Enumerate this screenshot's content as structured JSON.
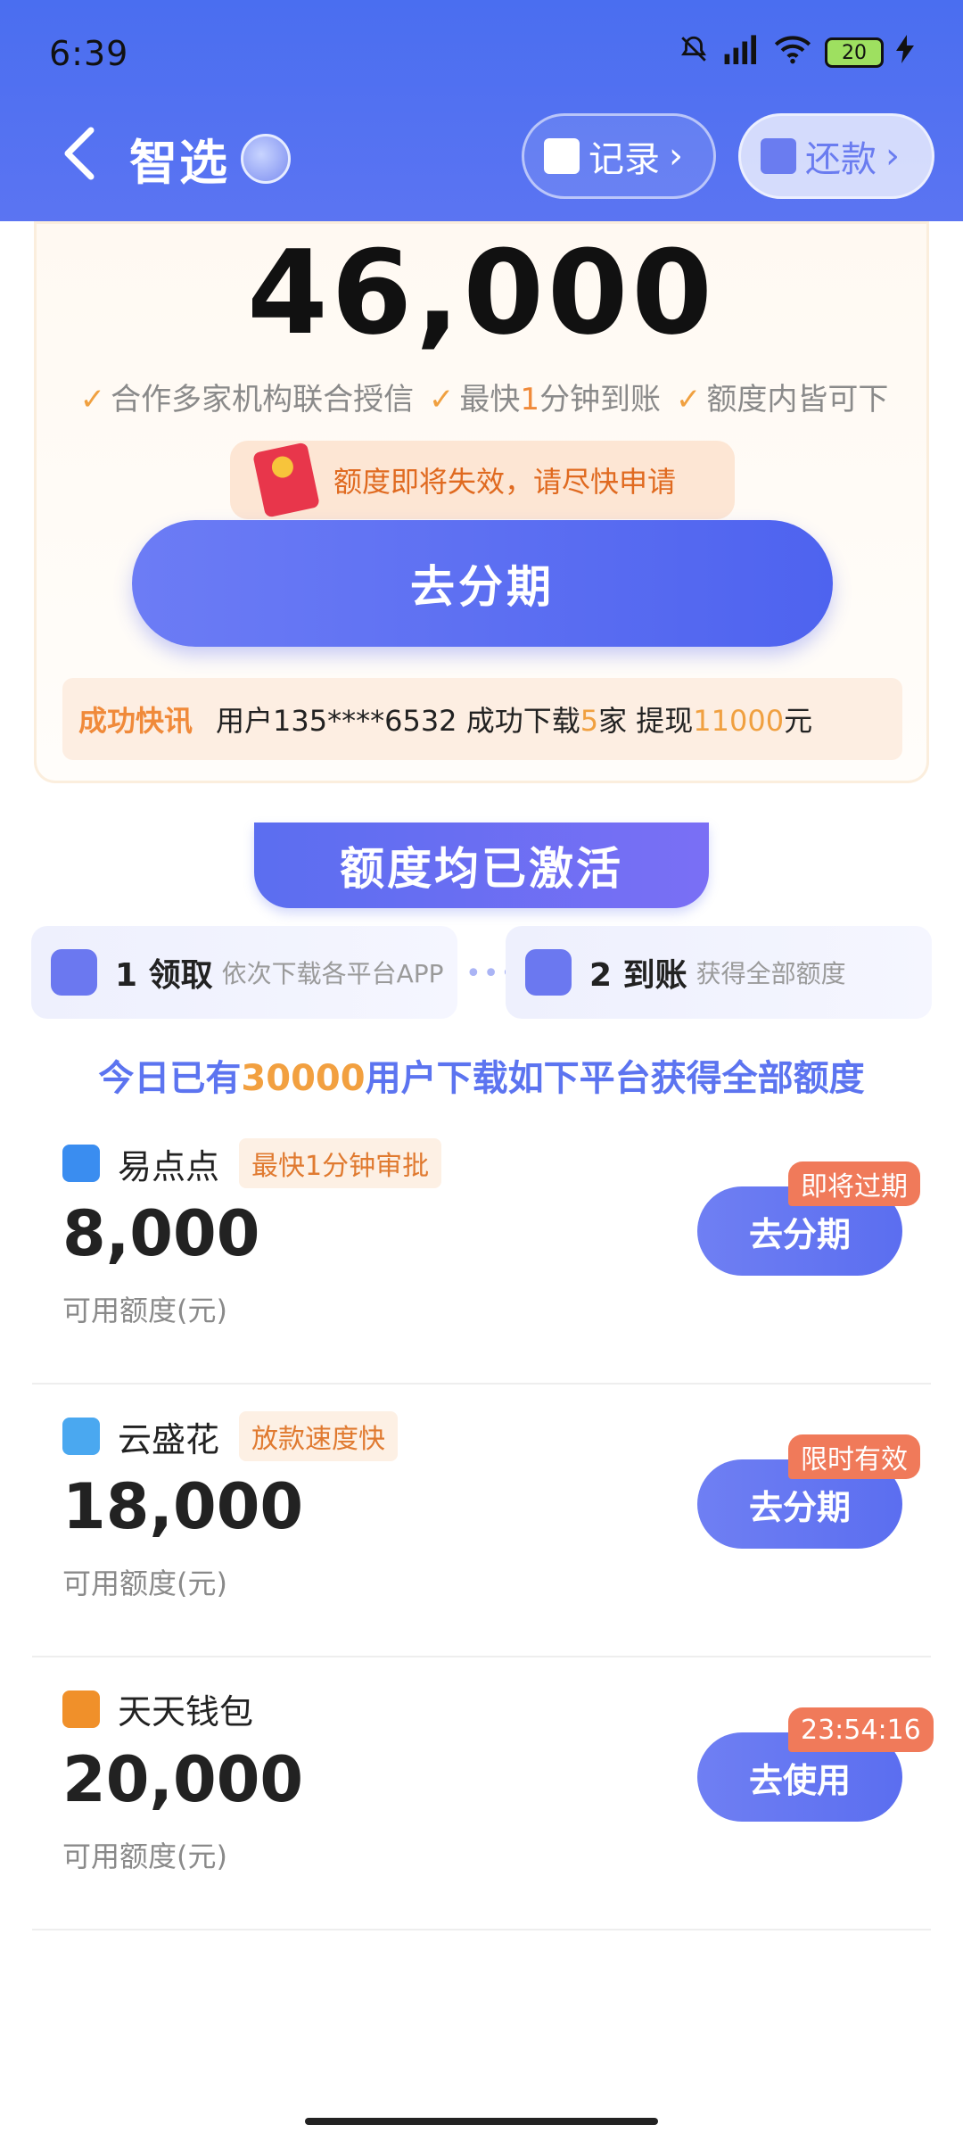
{
  "status_bar": {
    "time": "6:39",
    "battery": "20"
  },
  "nav": {
    "title": "智选",
    "record_label": "记录",
    "repay_label": "还款"
  },
  "hero": {
    "amount": "46,000",
    "features": [
      {
        "pre": "合作多家机构联合授信",
        "hl": "",
        "post": ""
      },
      {
        "pre": "最快",
        "hl": "1",
        "post": "分钟到账"
      },
      {
        "pre": "额度内皆可下",
        "hl": "",
        "post": ""
      }
    ],
    "warning": "额度即将失效，请尽快申请",
    "cta": "去分期"
  },
  "news": {
    "tag": "成功快讯",
    "user": "用户135****6532 成功下载",
    "count": "5",
    "mid": "家 提现",
    "amount": "11000",
    "unit": "元"
  },
  "banner": {
    "title": "额度均已激活"
  },
  "steps": [
    {
      "title": "1 领取",
      "desc": "依次下载各平台APP"
    },
    {
      "title": "2 到账",
      "desc": "获得全部额度"
    }
  ],
  "today": {
    "pre": "今日已有",
    "hl": "30000",
    "post": "用户下载如下平台获得全部额度"
  },
  "items": [
    {
      "name": "易点点",
      "badge": "最快1分钟审批",
      "amount": "8,000",
      "sub": "可用额度(元)",
      "button": "去分期",
      "corner": "即将过期",
      "logo_color": "#3a8df0"
    },
    {
      "name": "云盛花",
      "badge": "放款速度快",
      "amount": "18,000",
      "sub": "可用额度(元)",
      "button": "去分期",
      "corner": "限时有效",
      "logo_color": "#4aa8f0"
    },
    {
      "name": "天天钱包",
      "badge": "",
      "amount": "20,000",
      "sub": "可用额度(元)",
      "button": "去使用",
      "corner": "23:54:16",
      "logo_color": "#f0902a"
    }
  ],
  "colors": {
    "brand": "#5b6ef0",
    "accent": "#f08a3a"
  }
}
